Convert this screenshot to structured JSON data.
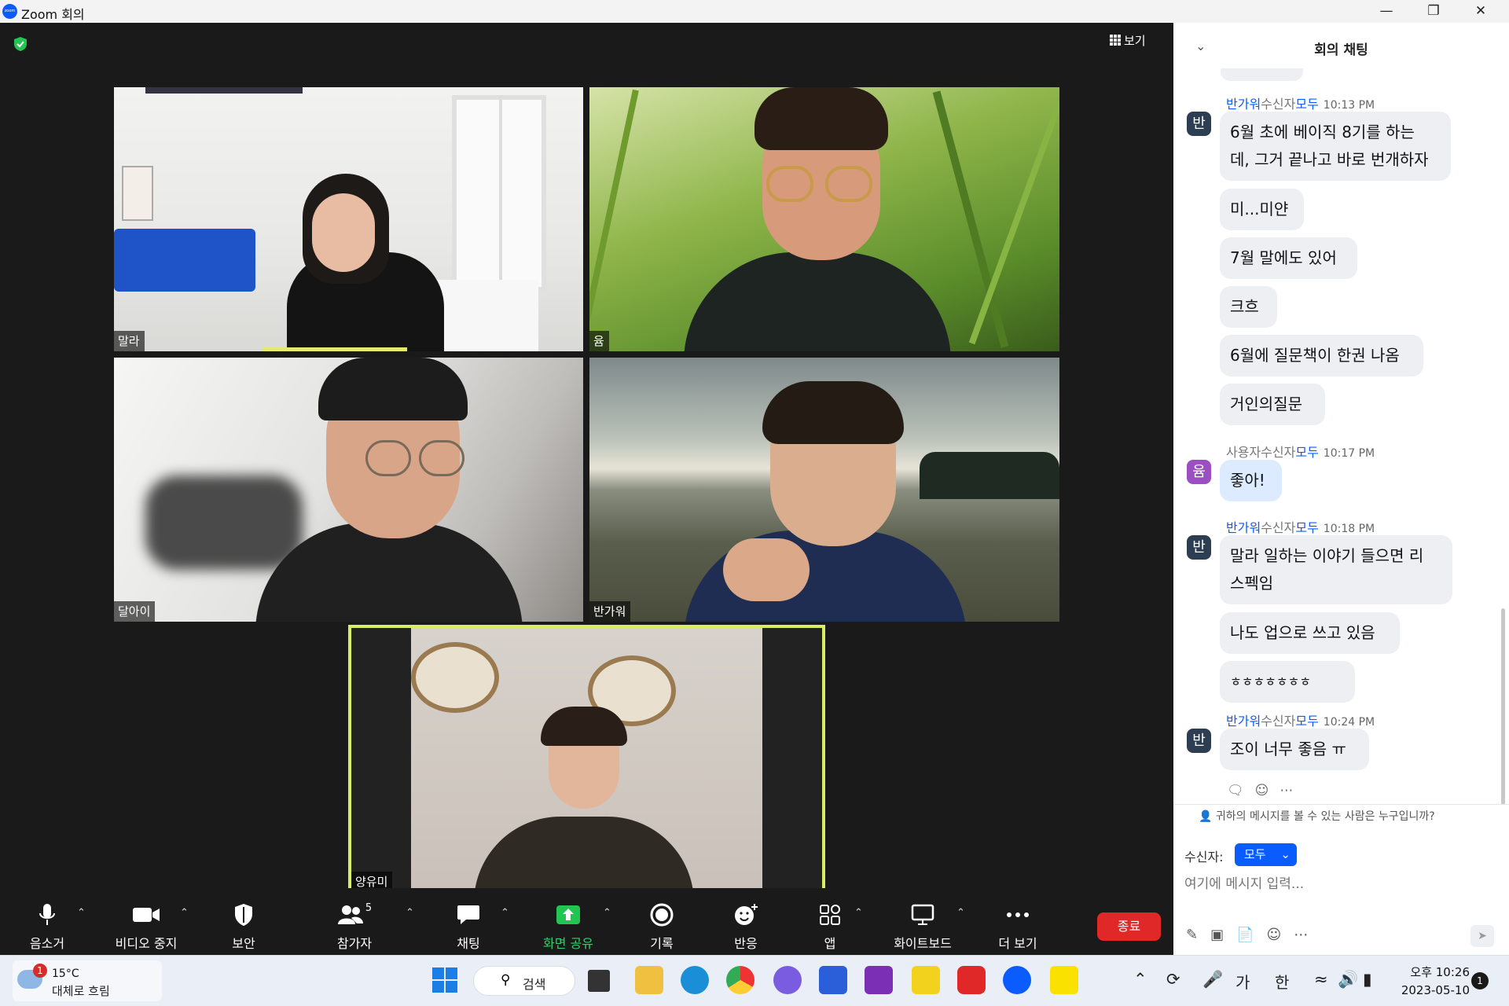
{
  "window": {
    "title": "Zoom 회의",
    "logo_text": "zoom"
  },
  "meeting": {
    "view_label": "보기",
    "participants": [
      {
        "name": "말라"
      },
      {
        "name": "윰"
      },
      {
        "name": "달아이"
      },
      {
        "name": "반가워"
      },
      {
        "name": "양유미"
      }
    ]
  },
  "toolbar": {
    "mute": "음소거",
    "video": "비디오 중지",
    "security": "보안",
    "participants": "참가자",
    "participants_count": "5",
    "chat": "채팅",
    "share": "화면 공유",
    "record": "기록",
    "reactions": "반응",
    "apps": "앱",
    "whiteboard": "화이트보드",
    "more": "더 보기",
    "end": "종료"
  },
  "chat": {
    "title": "회의 채팅",
    "groups": [
      {
        "sender": "반가워",
        "to_label": "수신자",
        "to": "모두",
        "time": "10:13 PM",
        "avatar": "반",
        "messages": [
          "6월 초에 베이직 8기를 하는",
          "데, 그거 끝나고 바로 번개하자",
          "미...미얀",
          "7월 말에도 있어",
          "크흐",
          "6월에 질문책이 한권 나옴",
          "거인의질문"
        ]
      },
      {
        "sender": "사용자",
        "to_label": "수신자",
        "to": "모두",
        "time": "10:17 PM",
        "avatar": "윰",
        "messages": [
          "좋아!"
        ]
      },
      {
        "sender": "반가워",
        "to_label": "수신자",
        "to": "모두",
        "time": "10:18 PM",
        "avatar": "반",
        "messages": [
          "말라 일하는 이야기 들으면 리",
          "스펙임",
          "나도 업으로 쓰고 있음",
          "ㅎㅎㅎㅎㅎㅎㅎ"
        ]
      },
      {
        "sender": "반가워",
        "to_label": "수신자",
        "to": "모두",
        "time": "10:24 PM",
        "avatar": "반",
        "messages": [
          "조이 너무 좋음 ㅠ"
        ]
      }
    ],
    "who_can_see": "귀하의 메시지를 볼 수 있는 사람은 누구입니까?",
    "recipient_label": "수신자:",
    "recipient_value": "모두",
    "input_placeholder": "여기에 메시지 입력..."
  },
  "taskbar": {
    "weather_temp": "15°C",
    "weather_desc": "대체로 흐림",
    "weather_badge": "1",
    "search_label": "검색",
    "ime_mode": "가",
    "ime_lang": "한",
    "time": "오후 10:26",
    "date": "2023-05-10",
    "notif_count": "1"
  }
}
